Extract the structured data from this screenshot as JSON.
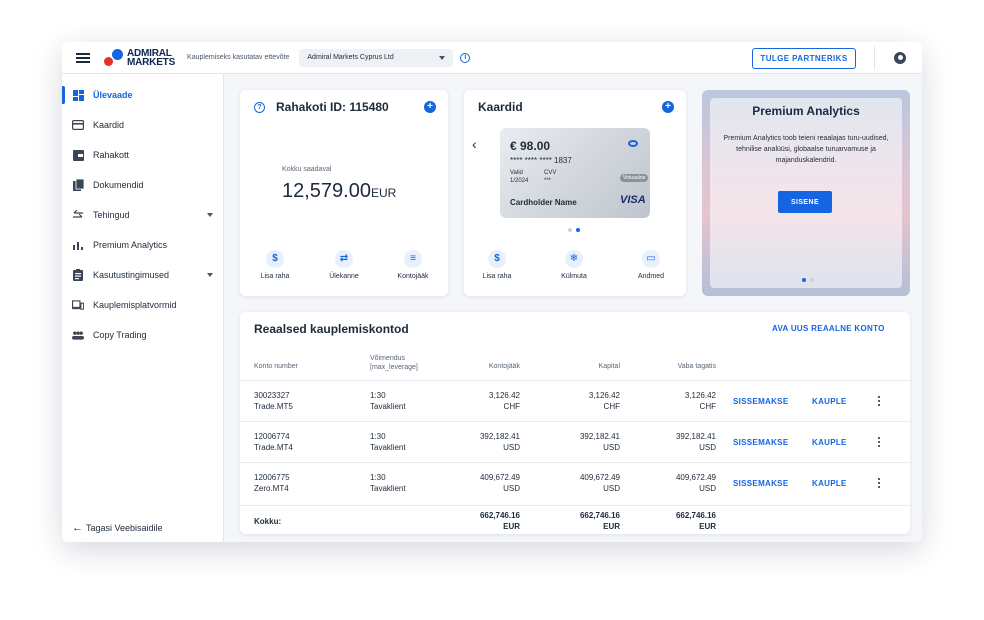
{
  "topbar": {
    "logo_line1": "ADMIRAL",
    "logo_line2": "MARKETS",
    "company_label": "Kauplemiseks kasutatav ettevõte",
    "company_value": "Admiral Markets Cyprus Ltd",
    "partner_button": "TULGE PARTNERIKS"
  },
  "sidebar": {
    "items": [
      {
        "label": "Ülevaade",
        "icon": "dashboard-icon",
        "active": true
      },
      {
        "label": "Kaardid",
        "icon": "card-icon"
      },
      {
        "label": "Rahakott",
        "icon": "wallet-icon"
      },
      {
        "label": "Dokumendid",
        "icon": "documents-icon"
      },
      {
        "label": "Tehingud",
        "icon": "transactions-icon",
        "expandable": true
      },
      {
        "label": "Premium Analytics",
        "icon": "analytics-icon"
      },
      {
        "label": "Kasutustingimused",
        "icon": "terms-icon",
        "expandable": true
      },
      {
        "label": "Kauplemisplatvormid",
        "icon": "platforms-icon"
      },
      {
        "label": "Copy Trading",
        "icon": "people-icon"
      }
    ],
    "back_link": "Tagasi Veebisaidile"
  },
  "wallet": {
    "title": "Rahakoti ID: 115480",
    "balance_label": "Kokku saadaval",
    "balance_amount": "12,579.00",
    "balance_currency": "EUR",
    "actions": [
      "Lisa raha",
      "Ülekanne",
      "Kontojääk"
    ]
  },
  "cards": {
    "title": "Kaardid",
    "amount": "€ 98.00",
    "number": "**** **** **** 1837",
    "valid_label": "Valid",
    "valid_value": "1/2024",
    "cvv_label": "CVV",
    "cvv_value": "***",
    "badge": "Virtuaalne",
    "holder": "Cardholder Name",
    "brand": "VISA",
    "actions": [
      "Lisa raha",
      "Külmuta",
      "Andmed"
    ]
  },
  "promo": {
    "title": "Premium Analytics",
    "text": "Premium Analytics toob teieni reaalajas turu-uudised, tehnilise analüüsi, globaalse turuarvamuse ja majanduskalendrid.",
    "button": "SISENE"
  },
  "accounts": {
    "title": "Reaalsed kauplemiskontod",
    "open_link": "AVA UUS REAALNE KONTO",
    "headers": {
      "account": "Konto number",
      "leverage": "Võimendus [max_leverage]",
      "balance": "Kontojääk",
      "capital": "Kapital",
      "margin": "Vaba tagatis"
    },
    "rows": [
      {
        "number": "30023327",
        "platform": "Trade.MT5",
        "leverage": "1:30",
        "type": "Tavaklient",
        "balance": "3,126.42",
        "capital": "3,126.42",
        "margin": "3,126.42",
        "currency": "CHF"
      },
      {
        "number": "12006774",
        "platform": "Trade.MT4",
        "leverage": "1:30",
        "type": "Tavaklient",
        "balance": "392,182.41",
        "capital": "392,182.41",
        "margin": "392,182.41",
        "currency": "USD"
      },
      {
        "number": "12006775",
        "platform": "Zero.MT4",
        "leverage": "1:30",
        "type": "Tavaklient",
        "balance": "409,672.49",
        "capital": "409,672.49",
        "margin": "409,672.49",
        "currency": "USD"
      }
    ],
    "deposit_label": "SISSEMAKSE",
    "trade_label": "KAUPLE",
    "total": {
      "label": "Kokku:",
      "balance": "662,746.16",
      "capital": "662,746.16",
      "margin": "662,746.16",
      "currency": "EUR"
    }
  },
  "colors": {
    "accent": "#1565e0",
    "text": "#1d2a3a",
    "background": "#f4f6f9"
  }
}
